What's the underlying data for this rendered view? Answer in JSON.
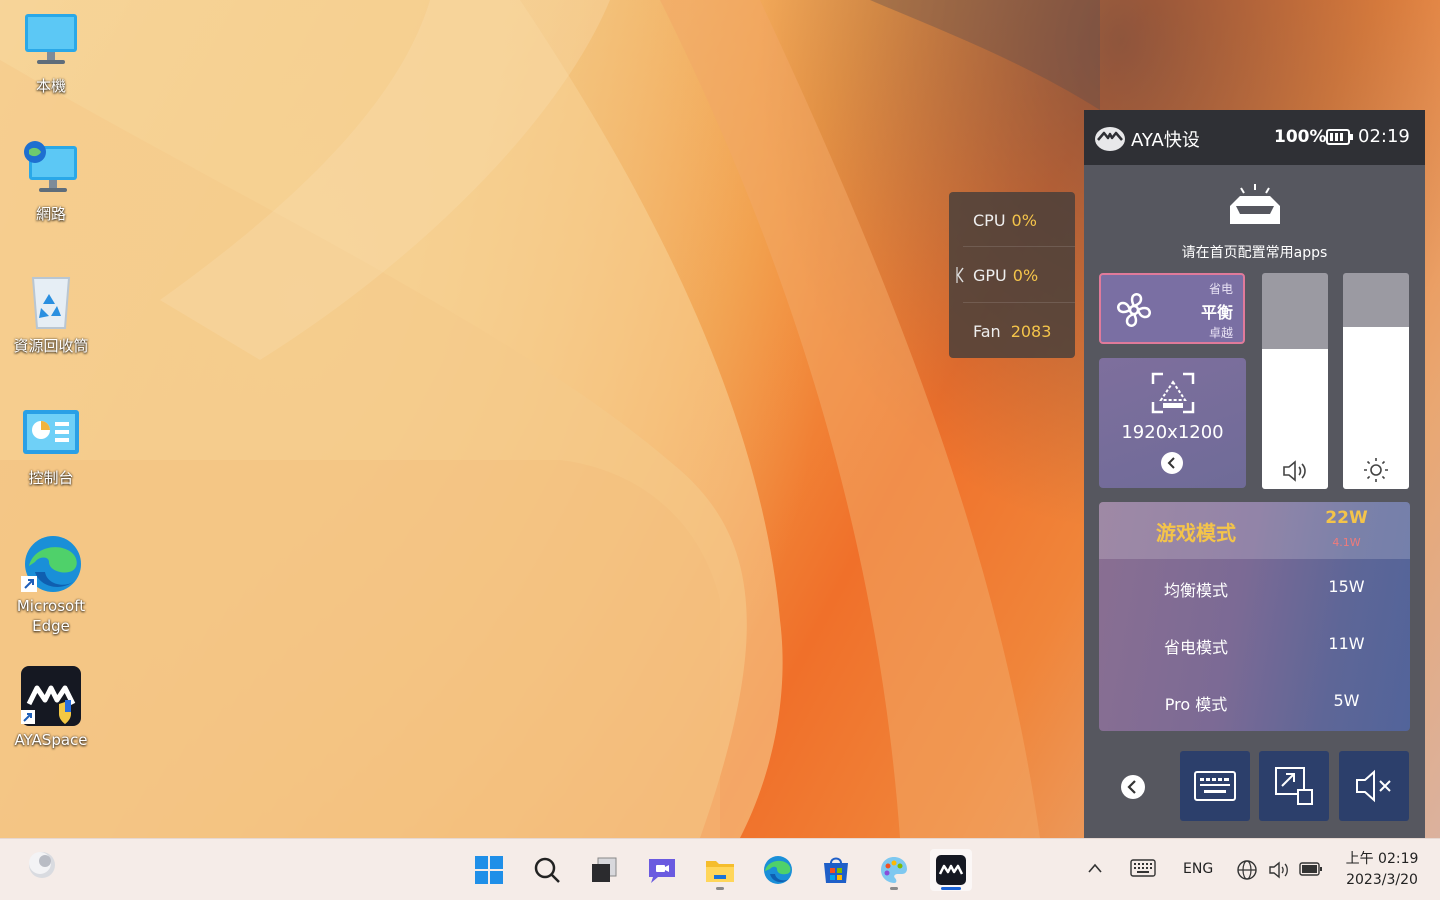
{
  "desktop": {
    "icons": [
      {
        "label": "本機"
      },
      {
        "label": "網路"
      },
      {
        "label": "資源回收筒"
      },
      {
        "label": "控制台"
      },
      {
        "label": "Microsoft Edge"
      },
      {
        "label": "AYASpace"
      }
    ]
  },
  "perf_overlay": {
    "cpu": {
      "label": "CPU",
      "value": "0%"
    },
    "gpu": {
      "label": "GPU",
      "value": "0%"
    },
    "fan": {
      "label": "Fan",
      "value": "2083"
    }
  },
  "aya_panel": {
    "title": "AYA快设",
    "battery_percent": "100%",
    "time": "02:19",
    "apps_hint": "请在首页配置常用apps",
    "power_profile": {
      "options": [
        "省电",
        "平衡",
        "卓越"
      ],
      "selected": "平衡"
    },
    "resolution": "1920x1200",
    "volume_level": 0.65,
    "brightness_level": 0.75,
    "modes": [
      {
        "name": "游戏模式",
        "power": "22W",
        "sub": "4.1W",
        "active": true
      },
      {
        "name": "均衡模式",
        "power": "15W",
        "active": false
      },
      {
        "name": "省电模式",
        "power": "11W",
        "active": false
      },
      {
        "name": "Pro 模式",
        "power": "5W",
        "active": false
      }
    ],
    "colors": {
      "accent": "#f4c44a",
      "button_bg": "#2c3f6b",
      "panel_bg": "#56575f"
    }
  },
  "taskbar": {
    "language": "ENG",
    "clock": {
      "time": "上午 02:19",
      "date": "2023/3/20"
    }
  }
}
